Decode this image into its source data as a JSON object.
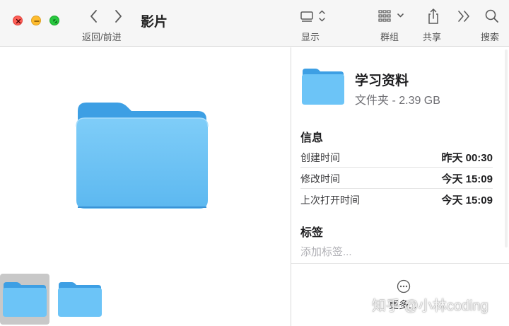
{
  "window": {
    "title": "影片"
  },
  "toolbar": {
    "nav_label": "返回/前进",
    "view_label": "显示",
    "group_label": "群组",
    "share_label": "共享",
    "search_label": "搜索",
    "icons": {
      "back": "chevron-left-icon",
      "forward": "chevron-right-icon",
      "view": "gallery-view-icon",
      "group": "group-grid-icon",
      "share": "share-icon",
      "more": "double-chevron-icon",
      "search": "search-icon"
    }
  },
  "gallery": {
    "selected_index": 0,
    "thumbnails": [
      "folder",
      "folder"
    ]
  },
  "inspector": {
    "name": "学习资料",
    "kind_size": "文件夹 - 2.39 GB",
    "info_title": "信息",
    "info_rows": [
      {
        "label": "创建时间",
        "value": "昨天 00:30"
      },
      {
        "label": "修改时间",
        "value": "今天 15:09"
      },
      {
        "label": "上次打开时间",
        "value": "今天 15:09"
      }
    ],
    "tags_title": "标签",
    "tags_placeholder": "添加标签...",
    "more_label": "更多..."
  },
  "watermark": "知乎 @小林coding",
  "colors": {
    "folder_blue": "#6cc4f7",
    "folder_tab": "#3da2e8",
    "close": "#fe5f57",
    "minimize": "#febc2e",
    "maximize": "#28c840"
  }
}
